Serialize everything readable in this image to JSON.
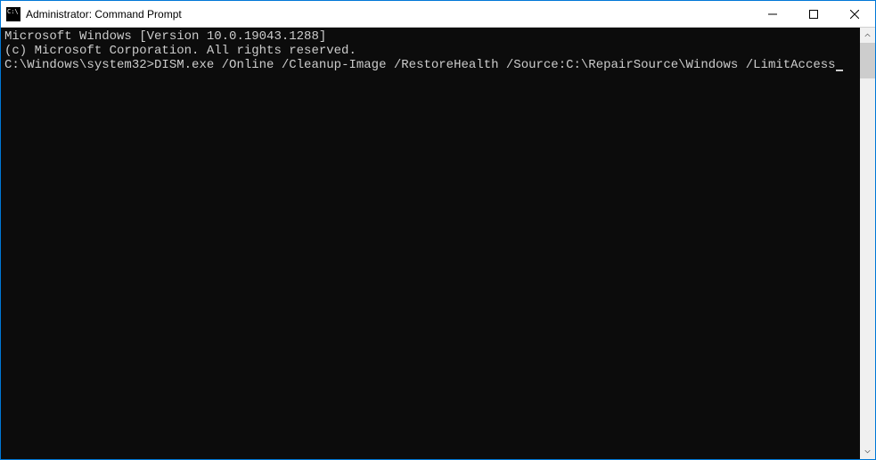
{
  "window": {
    "title": "Administrator: Command Prompt"
  },
  "terminal": {
    "line1": "Microsoft Windows [Version 10.0.19043.1288]",
    "line2": "(c) Microsoft Corporation. All rights reserved.",
    "blank": "",
    "prompt": "C:\\Windows\\system32>",
    "command": "DISM.exe /Online /Cleanup-Image /RestoreHealth /Source:C:\\RepairSource\\Windows /LimitAccess"
  }
}
